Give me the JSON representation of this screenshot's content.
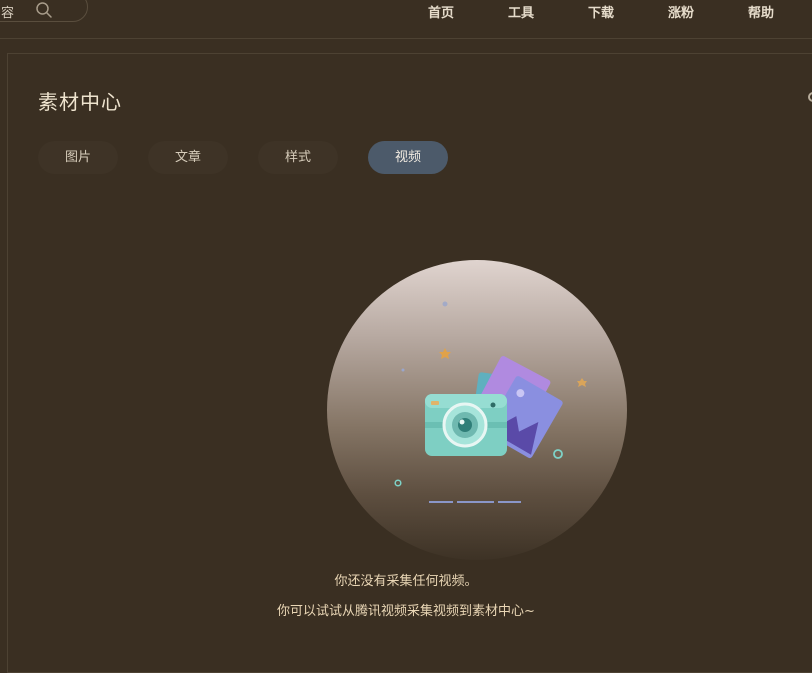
{
  "header": {
    "search_text": "容",
    "nav": [
      "首页",
      "工具",
      "下载",
      "涨粉",
      "帮助"
    ]
  },
  "main": {
    "title": "素材中心",
    "tabs": [
      {
        "label": "图片",
        "active": false
      },
      {
        "label": "文章",
        "active": false
      },
      {
        "label": "样式",
        "active": false
      },
      {
        "label": "视频",
        "active": true
      }
    ],
    "empty_state": {
      "line1": "你还没有采集任何视频。",
      "line2": "你可以试试从腾讯视频采集视频到素材中心~"
    }
  },
  "colors": {
    "background": "#3a2f22",
    "active_tab": "#4c5a6a",
    "message_text": "#e9d6b5"
  }
}
